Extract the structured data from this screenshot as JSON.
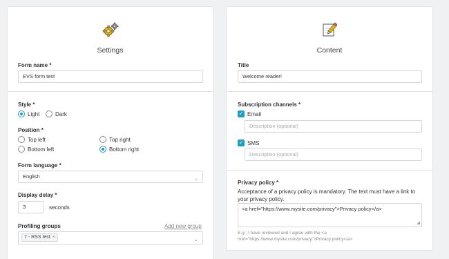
{
  "settings": {
    "title": "Settings",
    "form_name_label": "Form name *",
    "form_name_value": "EVS form test",
    "style_label": "Style *",
    "style_options": [
      "Light",
      "Dark"
    ],
    "style_selected": "Light",
    "position_label": "Position *",
    "position_options": [
      "Top left",
      "Top right",
      "Bottom left",
      "Bottom right"
    ],
    "position_selected": "Bottom right",
    "language_label": "Form language *",
    "language_value": "English",
    "delay_label": "Display delay *",
    "delay_value": "3",
    "delay_unit": "seconds",
    "groups_label": "Profiling groups",
    "add_group_link": "Add new group",
    "groups_tag": "7 - RSS test",
    "tag_remove": "×"
  },
  "content": {
    "title": "Content",
    "title_label": "Title",
    "title_value": "Welcome reader!",
    "channels_label": "Subscription channels *",
    "channels": [
      {
        "label": "Email",
        "checked": true,
        "placeholder": "Description (optional)"
      },
      {
        "label": "SMS",
        "checked": true,
        "placeholder": "Description (optional)"
      }
    ],
    "privacy_label": "Privacy policy *",
    "privacy_text": "Acceptance of a privacy policy is mandatory. The text must have a link to your privacy policy.",
    "privacy_value": "<a href=\"https://www.mysite.com/privacy\">Privacy policy</a>",
    "privacy_hint": "E.g.: I have reviewed and I agree with the <a href=\"https://www.mysite.com/privacy\">Privacy policy</a>"
  },
  "colors": {
    "accent": "#1a9ec2",
    "icon_gold": "#e9b200",
    "icon_gray": "#8a8a8a"
  },
  "icons": {
    "settings": "gears-icon",
    "content": "notepad-pencil-icon",
    "select": "chevron-down-icon",
    "check": "checkmark-icon"
  }
}
